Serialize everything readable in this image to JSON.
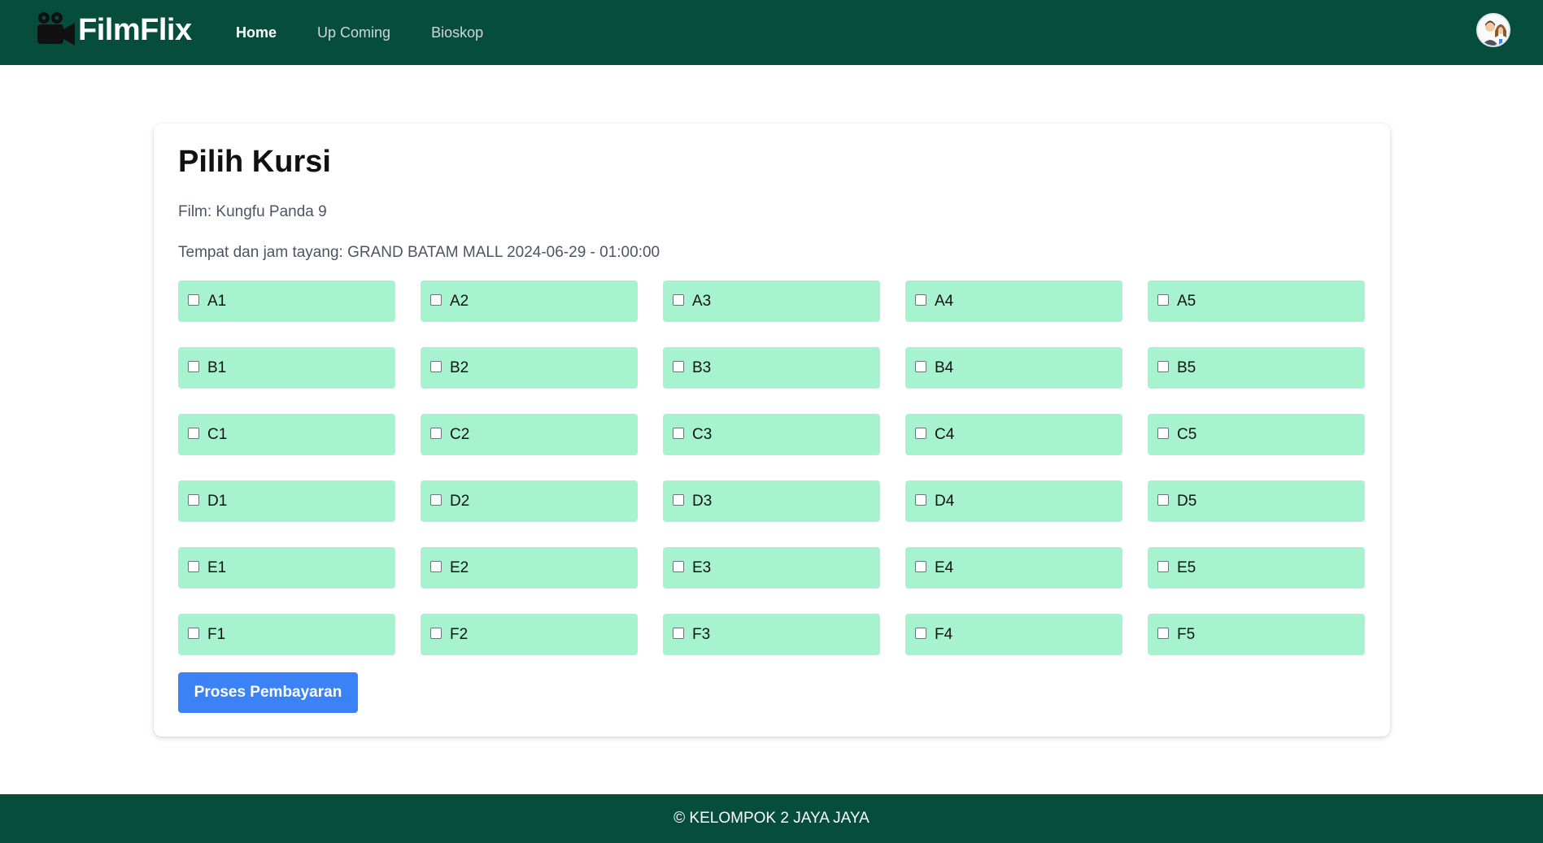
{
  "brand": {
    "name": "FilmFlix",
    "icon": "movie-camera-icon"
  },
  "nav": {
    "items": [
      {
        "label": "Home",
        "active": true
      },
      {
        "label": "Up Coming",
        "active": false
      },
      {
        "label": "Bioskop",
        "active": false
      }
    ]
  },
  "user": {
    "avatar": "user-avatar"
  },
  "page": {
    "title": "Pilih Kursi",
    "film": "Film: Kungfu Panda 9",
    "tempat": "Tempat dan jam tayang: GRAND BATAM MALL 2024-06-29 - 01:00:00"
  },
  "seats": [
    [
      "A1",
      "A2",
      "A3",
      "A4",
      "A5"
    ],
    [
      "B1",
      "B2",
      "B3",
      "B4",
      "B5"
    ],
    [
      "C1",
      "C2",
      "C3",
      "C4",
      "C5"
    ],
    [
      "D1",
      "D2",
      "D3",
      "D4",
      "D5"
    ],
    [
      "E1",
      "E2",
      "E3",
      "E4",
      "E5"
    ],
    [
      "F1",
      "F2",
      "F3",
      "F4",
      "F5"
    ]
  ],
  "actions": {
    "pay_label": "Proses Pembayaran"
  },
  "footer": {
    "text": "© KELOMPOK 2 JAYA JAYA"
  },
  "colors": {
    "nav_bg": "#064e3b",
    "seat_bg": "#a7f3d0",
    "button_bg": "#3b82f6"
  }
}
